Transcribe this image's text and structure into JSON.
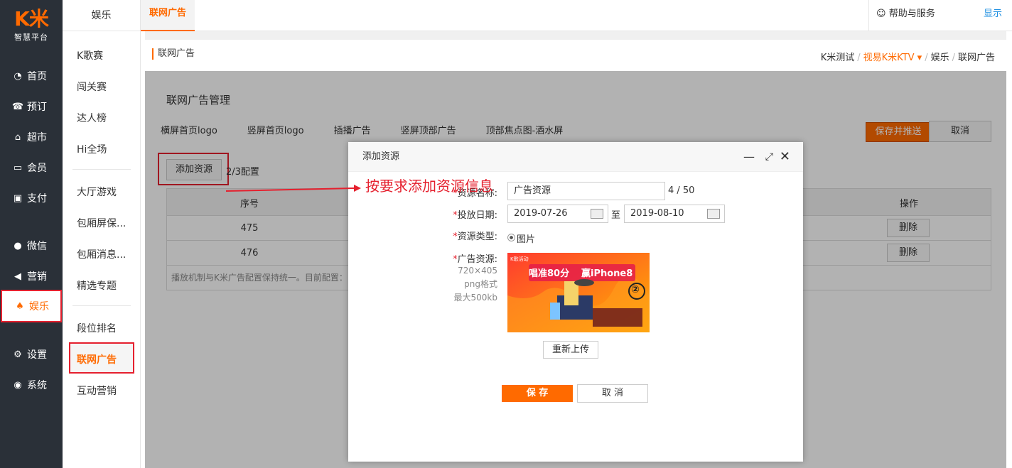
{
  "logo": {
    "mark": "K米",
    "sub": "智慧平台"
  },
  "nav": [
    {
      "label": "首页",
      "icon": "dashboard-icon"
    },
    {
      "label": "预订",
      "icon": "phone-icon"
    },
    {
      "label": "超市",
      "icon": "shop-icon"
    },
    {
      "label": "会员",
      "icon": "card-icon"
    },
    {
      "label": "支付",
      "icon": "payment-icon"
    },
    {
      "label": "微信",
      "icon": "wechat-icon"
    },
    {
      "label": "营销",
      "icon": "megaphone-icon"
    },
    {
      "label": "娱乐",
      "icon": "entertainment-icon"
    },
    {
      "label": "设置",
      "icon": "gear-icon"
    },
    {
      "label": "系统",
      "icon": "chrome-icon"
    }
  ],
  "sub": {
    "head": "娱乐",
    "items": [
      "K歌赛",
      "闯关赛",
      "达人榜",
      "Hi全场",
      "大厅游戏",
      "包厢屏保...",
      "包厢消息...",
      "精选专题",
      "段位排名",
      "联网广告",
      "互动营销"
    ]
  },
  "top": {
    "tab": "联网广告",
    "help": "帮助与服务",
    "show": "显示"
  },
  "breadcrumb": {
    "title": "联网广告",
    "items": [
      "K米测试",
      "视易K米KTV",
      "娱乐",
      "联网广告"
    ]
  },
  "panel": {
    "title": "联网广告管理",
    "tabs": [
      "横屏首页logo",
      "竖屏首页logo",
      "插播广告",
      "竖屏顶部广告",
      "顶部焦点图-酒水屏"
    ],
    "save_push": "保存并推送",
    "cancel": "取消",
    "add_resource": "添加资源",
    "config": "2/3配置",
    "table": {
      "headers": [
        "序号",
        "操作"
      ],
      "rows": [
        {
          "seq": "475",
          "op": "删除"
        },
        {
          "seq": "476",
          "op": "删除"
        }
      ],
      "footer": "播放机制与K米广告配置保持统一。目前配置：..."
    }
  },
  "modal": {
    "title": "添加资源",
    "name_label": "资源名称:",
    "name_value": "广告资源",
    "name_count": "4 / 50",
    "date_label": "投放日期:",
    "date_from": "2019-07-26",
    "date_to_sep": "至",
    "date_to": "2019-08-10",
    "type_label": "资源类型:",
    "type_value": "图片",
    "res_label": "广告资源:",
    "hints": [
      "720×405",
      "png格式",
      "最大500kb"
    ],
    "ad": {
      "brand": "K歌活动",
      "headline1": "唱准80分",
      "headline2": "赢iPhone8",
      "badge": "②"
    },
    "reupload": "重新上传",
    "save": "保 存",
    "cancel": "取 消"
  },
  "annotation": "按要求添加资源信息",
  "colors": {
    "accent": "#ff6a00",
    "highlight": "#e5202e",
    "sidebar": "#2a3038"
  }
}
